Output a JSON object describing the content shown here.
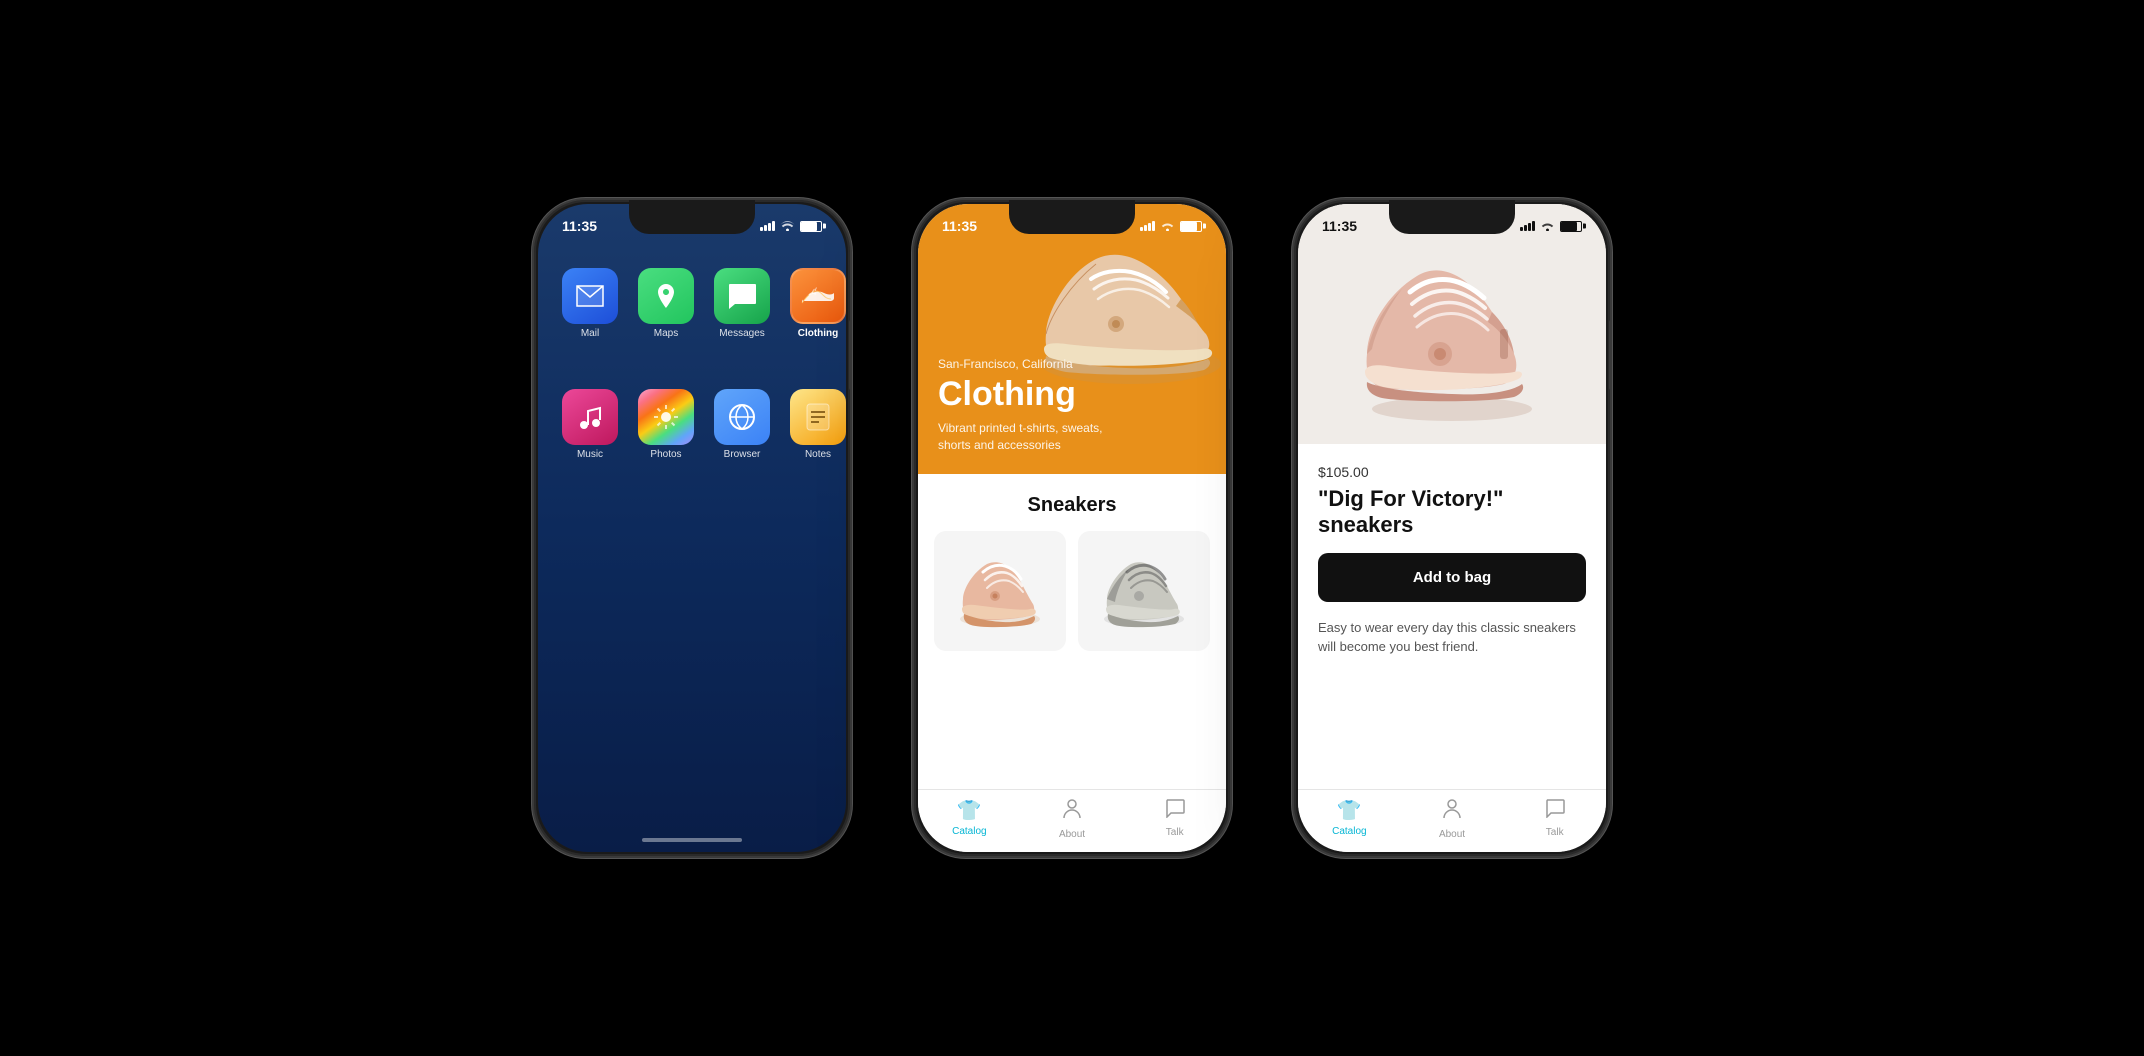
{
  "colors": {
    "bg": "#000000",
    "phone_shell": "#1a1a1a",
    "hero_orange": "#e8901a",
    "tab_active": "#06b6d4",
    "tab_inactive": "#999999",
    "button_dark": "#111111",
    "home_bg_top": "#1a3a6b",
    "home_bg_bottom": "#091d47"
  },
  "status_bar": {
    "time": "11:35"
  },
  "phone1": {
    "apps": [
      {
        "name": "Mail",
        "label": "Mail"
      },
      {
        "name": "Maps",
        "label": "Maps"
      },
      {
        "name": "Messages",
        "label": "Messages"
      },
      {
        "name": "Clothing",
        "label": "Clothing",
        "selected": true
      }
    ],
    "apps_row2": [
      {
        "name": "Music",
        "label": "Music"
      },
      {
        "name": "Photos",
        "label": "Photos"
      },
      {
        "name": "Browser",
        "label": "Browser"
      },
      {
        "name": "Notes",
        "label": "Notes"
      }
    ]
  },
  "phone2": {
    "hero": {
      "location": "San-Francisco, California",
      "title": "Clothing",
      "subtitle": "Vibrant printed t-shirts, sweats, shorts and accessories"
    },
    "section_title": "Sneakers",
    "tabs": [
      {
        "label": "Catalog",
        "active": true
      },
      {
        "label": "About",
        "active": false
      },
      {
        "label": "Talk",
        "active": false
      }
    ]
  },
  "phone3": {
    "product": {
      "price": "$105.00",
      "name": "\"Dig For Victory!\" sneakers",
      "add_to_bag": "Add to bag",
      "description": "Easy to wear every day this classic sneakers will become you best friend."
    },
    "tabs": [
      {
        "label": "Catalog",
        "active": true
      },
      {
        "label": "About",
        "active": false
      },
      {
        "label": "Talk",
        "active": false
      }
    ]
  }
}
